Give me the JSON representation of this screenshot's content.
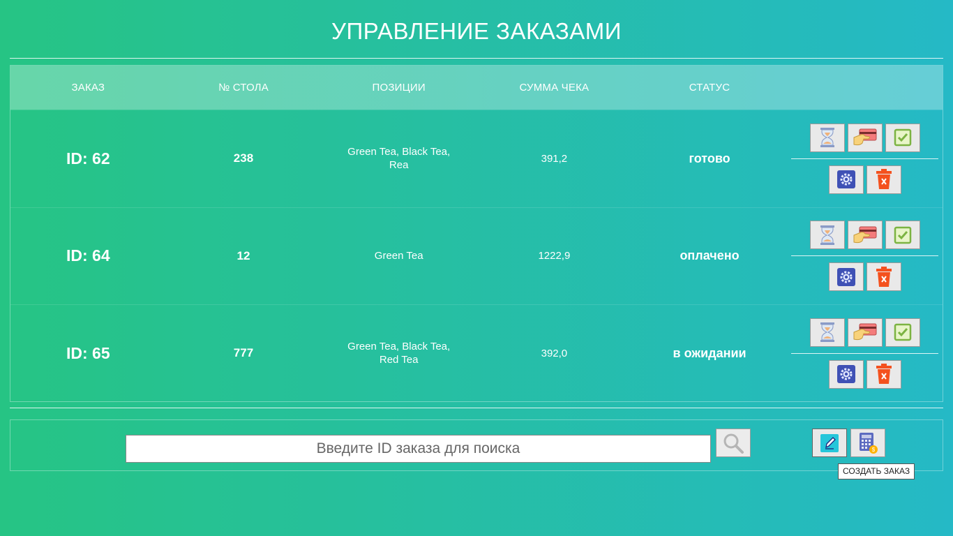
{
  "header": {
    "title": "УПРАВЛЕНИЕ ЗАКАЗАМИ"
  },
  "table": {
    "columns": [
      "ЗАКАЗ",
      "№ СТОЛА",
      "ПОЗИЦИИ",
      "СУММА ЧЕКА",
      "СТАТУС"
    ],
    "rows": [
      {
        "id": "ID: 62",
        "table_no": "238",
        "items": "Green Tea, Black Tea, Rea",
        "sum": "391,2",
        "status": "готово"
      },
      {
        "id": "ID: 64",
        "table_no": "12",
        "items": "Green Tea",
        "sum": "1222,9",
        "status": "оплачено"
      },
      {
        "id": "ID: 65",
        "table_no": "777",
        "items": "Green Tea, Black Tea, Red Tea",
        "sum": "392,0",
        "status": "в ожидании"
      }
    ],
    "row_actions": [
      "hourglass-icon",
      "credit-card-icon",
      "checkmark-icon",
      "gear-icon",
      "trash-icon"
    ]
  },
  "search": {
    "placeholder": "Введите ID заказа для поиска",
    "value": ""
  },
  "toolbar": {
    "tooltip": "СОЗДАТЬ ЗАКАЗ"
  },
  "colors": {
    "gradient_start": "#26c484",
    "gradient_end": "#25b9c6",
    "check_green": "#7cb342",
    "gear_blue": "#3f51b5",
    "trash_red": "#f4511e"
  }
}
